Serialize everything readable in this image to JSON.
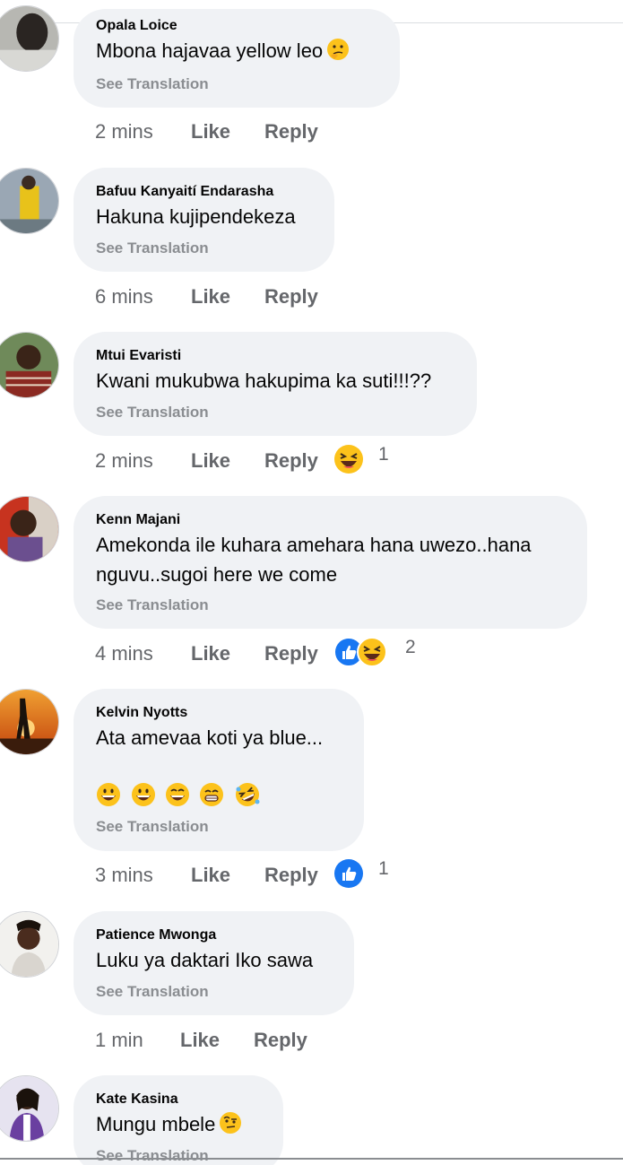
{
  "comments": [
    {
      "author": "Opala Loice",
      "text": "Mbona hajavaa yellow leo",
      "text_emoji": "thinking-face",
      "see_translation": "See Translation",
      "time": "2 mins",
      "like": "Like",
      "reply": "Reply"
    },
    {
      "author": "Bafuu Kanyaití Endarasha",
      "text": "Hakuna kujipendekeza",
      "see_translation": "See Translation",
      "time": "6 mins",
      "like": "Like",
      "reply": "Reply"
    },
    {
      "author": "Mtui Evaristi",
      "text": "Kwani mukubwa hakupima ka suti!!!??",
      "see_translation": "See Translation",
      "time": "2 mins",
      "like": "Like",
      "reply": "Reply",
      "reactions": [
        "laughing-squint-icon"
      ],
      "reaction_count": "1"
    },
    {
      "author": "Kenn Majani",
      "text_line1": "Amekonda ile kuhara amehara hana uwezo..hana",
      "text_line2": "nguvu..sugoi here we come",
      "see_translation": "See Translation",
      "time": "4 mins",
      "like": "Like",
      "reply": "Reply",
      "reactions": [
        "like-reaction-icon",
        "laughing-squint-icon"
      ],
      "reaction_count": "2"
    },
    {
      "author": "Kelvin Nyotts",
      "text": "Ata amevaa koti ya blue...",
      "emoji_line": [
        "grinning-face",
        "grinning-face",
        "grinning-smile",
        "beaming-face",
        "rolling-laughing-face"
      ],
      "see_translation": "See Translation",
      "time": "3 mins",
      "like": "Like",
      "reply": "Reply",
      "reactions": [
        "like-reaction-icon"
      ],
      "reaction_count": "1"
    },
    {
      "author": "Patience Mwonga",
      "text": "Luku ya daktari Iko sawa",
      "see_translation": "See Translation",
      "time": "1 min",
      "like": "Like",
      "reply": "Reply"
    },
    {
      "author": "Kate Kasina",
      "text": "Mungu mbele",
      "text_emoji": "face-with-raised-eyebrow",
      "see_translation": "See Translation"
    }
  ],
  "colors": {
    "bubble": "#f0f2f5",
    "secondary_text": "#65676b",
    "translation_text": "#8a8d91",
    "like_blue": "#1877f2",
    "emoji_yellow": "#fcc21b"
  }
}
